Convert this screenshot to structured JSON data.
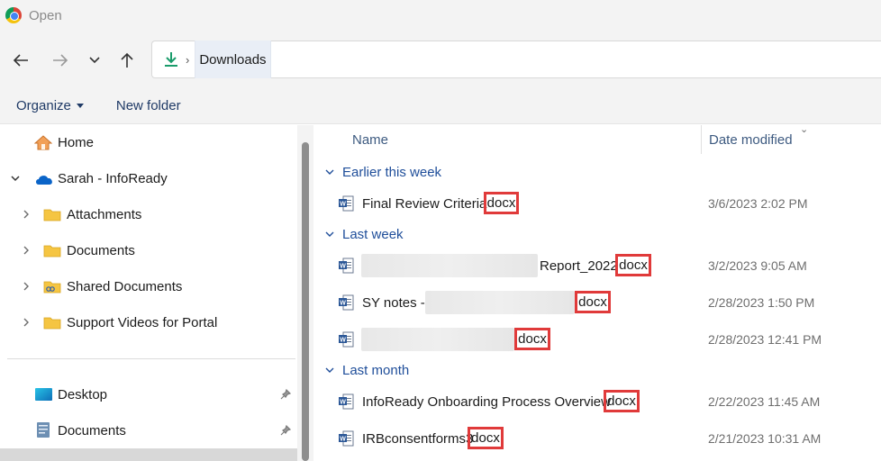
{
  "window": {
    "title": "Open"
  },
  "address": {
    "crumb": "Downloads"
  },
  "commands": {
    "organize": "Organize",
    "new_folder": "New folder"
  },
  "nav": {
    "home": "Home",
    "account": "Sarah - InfoReady",
    "folders": [
      "Attachments",
      "Documents",
      "Shared Documents",
      "Support Videos for Portal"
    ],
    "quick": [
      "Desktop",
      "Documents"
    ]
  },
  "columns": {
    "name": "Name",
    "date_modified": "Date modified"
  },
  "groups": [
    {
      "label": "Earlier this week"
    },
    {
      "label": "Last week"
    },
    {
      "label": "Last month"
    }
  ],
  "files": [
    {
      "prefix": "Final Review Criteria",
      "ext": "docx",
      "date": "3/6/2023 2:02 PM"
    },
    {
      "prefix": "Report_2022",
      "ext": "docx",
      "date": "3/2/2023 9:05 AM"
    },
    {
      "prefix": "SY notes -",
      "ext": "docx",
      "date": "2/28/2023 1:50 PM"
    },
    {
      "prefix": "",
      "ext": "docx",
      "date": "2/28/2023 12:41 PM"
    },
    {
      "prefix": "InfoReady Onboarding Process Overview",
      "ext": "docx",
      "date": "2/22/2023 11:45 AM"
    },
    {
      "prefix": "IRBconsentforms3",
      "ext": "docx",
      "date": "2/21/2023 10:31 AM"
    }
  ],
  "colors": {
    "accent": "#1f4e9a",
    "highlight_box": "#e03a3a",
    "selected": "#d8d8d8"
  },
  "icons": [
    "chrome-icon",
    "back-icon",
    "forward-icon",
    "recent-dropdown-icon",
    "up-icon",
    "download-icon",
    "home-icon",
    "onedrive-icon",
    "folder-icon",
    "shared-folder-icon",
    "desktop-icon",
    "documents-icon",
    "pin-icon",
    "word-doc-icon"
  ]
}
